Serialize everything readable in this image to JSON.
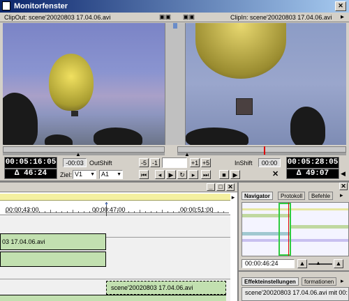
{
  "window": {
    "title": "Monitorfenster"
  },
  "monitor": {
    "clip_out_label": "ClipOut: scene'20020803 17.04.06.avi",
    "clip_in_label": "ClipIn: scene'20020803 17.04.06.avi",
    "left_timecode": "00:05:16:05",
    "left_duration": "Δ 46:24",
    "out_shift_value": "-00:03",
    "out_shift_label": "OutShift",
    "in_shift_label": "InShift",
    "in_shift_value": "00:00",
    "right_timecode": "00:05:28:05",
    "right_duration": "Δ 49:07",
    "trim_minus5": "-5",
    "trim_minus1": "-1",
    "trim_plus1": "+1",
    "trim_plus5": "+5",
    "target_label": "Ziel:",
    "target_video": "V1",
    "target_audio": "A1"
  },
  "timeline": {
    "time_markers": [
      "00:00:43:00",
      "00:00:47:00",
      "00:00:51:00"
    ],
    "clip1_label": "03 17.04.06.avi",
    "clip3_label": "scene'20020803 17.04.06.avi"
  },
  "navigator": {
    "tabs": [
      "Navigator",
      "Protokoll",
      "Befehle"
    ],
    "timecode": "00:00:46:24"
  },
  "effects": {
    "tabs": [
      "Effekteinstellungen",
      "formationen"
    ],
    "clip_label": "scene'20020803 17.04.06.avi mit 00:"
  },
  "colors": {
    "clip_green": "#c2e0b0",
    "title_blue": "#0a246a",
    "nav_frame_green": "#2ecc40"
  }
}
